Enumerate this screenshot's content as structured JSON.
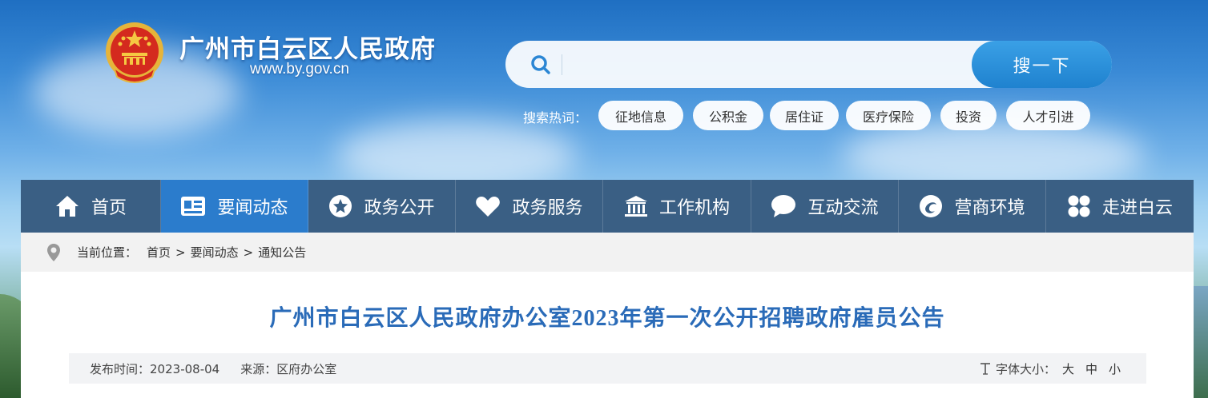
{
  "header": {
    "site_title": "广州市白云区人民政府",
    "site_url": "www.by.gov.cn"
  },
  "search": {
    "placeholder": "",
    "button_label": "搜一下",
    "hot_label": "搜索热词：",
    "hot_terms": [
      "征地信息",
      "公积金",
      "居住证",
      "医疗保险",
      "投资",
      "人才引进"
    ]
  },
  "nav": {
    "items": [
      {
        "label": "首页",
        "icon": "home-icon"
      },
      {
        "label": "要闻动态",
        "icon": "news-icon",
        "active": true
      },
      {
        "label": "政务公开",
        "icon": "star-icon"
      },
      {
        "label": "政务服务",
        "icon": "heart-icon"
      },
      {
        "label": "工作机构",
        "icon": "building-icon"
      },
      {
        "label": "互动交流",
        "icon": "chat-icon"
      },
      {
        "label": "营商环境",
        "icon": "swirl-icon"
      },
      {
        "label": "走进白云",
        "icon": "grid-icon"
      }
    ]
  },
  "breadcrumb": {
    "prefix": "当前位置：",
    "items": [
      "首页",
      "要闻动态",
      "通知公告"
    ],
    "separator": ">"
  },
  "article": {
    "title": "广州市白云区人民政府办公室2023年第一次公开招聘政府雇员公告",
    "publish_label": "发布时间：",
    "publish_date": "2023-08-04",
    "source_label": "来源：",
    "source": "区府办公室",
    "font_size_label": "字体大小：",
    "font_sizes": [
      "大",
      "中",
      "小"
    ]
  },
  "colors": {
    "nav_bg": "#3a5f84",
    "nav_active": "#2b7ccc",
    "title_blue": "#2a6bb8",
    "search_button": "#1f82cf"
  }
}
